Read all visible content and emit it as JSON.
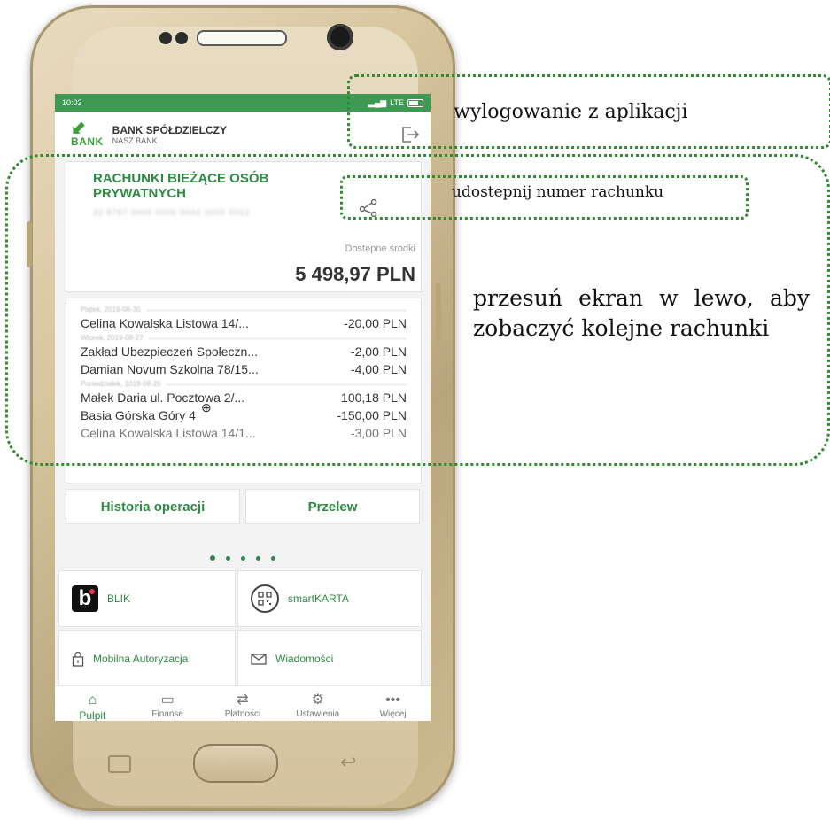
{
  "status": {
    "time": "10:02",
    "network": "LTE"
  },
  "header": {
    "logo_top": "nasz",
    "logo_word": "BANK",
    "bank_name": "BANK SPÓŁDZIELCZY",
    "bank_sub": "NASZ BANK",
    "logout_icon": "logout-icon"
  },
  "account": {
    "title": "RACHUNKI BIEŻĄCE OSÓB PRYWATNYCH",
    "number": "22 8787 0000 0000 0044 3000 0012",
    "available_label": "Dostępne środki",
    "balance": "5 498,97 PLN"
  },
  "history": [
    {
      "type": "day",
      "label": "Piątek, 2019-08-30"
    },
    {
      "type": "tx",
      "name": "Celina Kowalska Listowa 14/...",
      "amount": "-20,00 PLN"
    },
    {
      "type": "day",
      "label": "Wtorek, 2019-08-27"
    },
    {
      "type": "tx",
      "name": "Zakład Ubezpieczeń Społeczn...",
      "amount": "-2,00 PLN"
    },
    {
      "type": "tx",
      "name": "Damian Novum Szkolna 78/15...",
      "amount": "-4,00 PLN"
    },
    {
      "type": "day",
      "label": "Poniedziałek, 2019-08-26"
    },
    {
      "type": "tx",
      "name": "Małek Daria  ul. Pocztowa 2/...",
      "amount": "100,18 PLN"
    },
    {
      "type": "tx",
      "name": "Basia Górska Góry 4",
      "amount": "-150,00 PLN"
    },
    {
      "type": "tx",
      "name": "Celina Kowalska Listowa 14/1...",
      "amount": "-3,00 PLN",
      "fade": true
    }
  ],
  "actions": {
    "history_label": "Historia operacji",
    "transfer_label": "Przelew"
  },
  "tiles": {
    "blik": "BLIK",
    "smartkarta": "smartKARTA",
    "mobile_auth": "Mobilna Autoryzacja",
    "messages": "Wiadomości"
  },
  "nav": [
    {
      "label": "Pulpit",
      "icon": "home-icon"
    },
    {
      "label": "Finanse",
      "icon": "wallet-icon"
    },
    {
      "label": "Płatności",
      "icon": "transfer-icon"
    },
    {
      "label": "Ustawienia",
      "icon": "gear-icon"
    },
    {
      "label": "Więcej",
      "icon": "more-icon"
    }
  ],
  "callouts": {
    "logout": "wylogowanie z aplikacji",
    "share": "udostepnij numer rachunku",
    "swipe": "przesuń ekran w lewo, aby zobaczyć kolejne rachunki"
  },
  "colors": {
    "accent": "#2d8a43",
    "status_bar": "#3e9a52",
    "callout_border": "#2e8b2e"
  }
}
